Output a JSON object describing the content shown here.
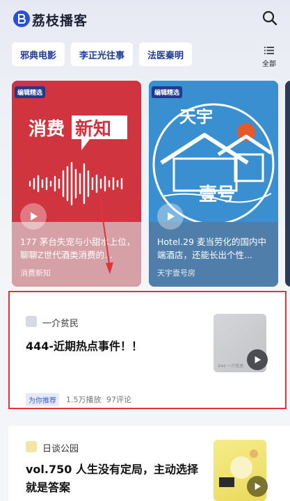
{
  "header": {
    "app_title": "荔枝播客",
    "logo_icon": "podcast-logo-icon",
    "search_icon": "search-icon"
  },
  "tags": [
    "邪典电影",
    "李正光往事",
    "法医秦明"
  ],
  "all_label": "全部",
  "cards": [
    {
      "badge": "编辑精选",
      "art_text_1": "消费",
      "art_text_2": "新知",
      "title": "177 茅台失宠与小甜水上位，聊聊Z世代酒类消费的...",
      "author": "消费新知"
    },
    {
      "badge": "编辑精选",
      "art_text_1": "天宇",
      "art_text_2": "壹号",
      "title": "Hotel.29 麦当劳化的国内中端酒店，还能长出个性...",
      "author": "天宇壹号房"
    }
  ],
  "feed": [
    {
      "author": "一介贫民",
      "title": "444-近期热点事件！！",
      "thumb_text": "444 一介贫民",
      "rec_badge": "为你推荐",
      "plays": "1.5万播放",
      "comments": "97评论"
    },
    {
      "author": "日谈公园",
      "title": "vol.750 人生没有定局，主动选择就是答案"
    }
  ],
  "colors": {
    "brand": "#2b4fd6",
    "card1": "#d0343f",
    "card2": "#3a8fd0",
    "highlight_border": "#e0333a"
  }
}
